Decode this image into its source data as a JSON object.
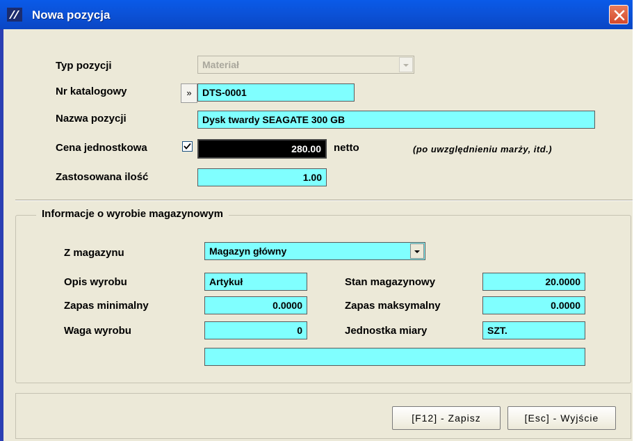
{
  "window": {
    "title": "Nowa pozycja",
    "icon": "app-logo-icon",
    "close_icon": "close-icon"
  },
  "header": {
    "type_label": "Typ pozycji",
    "type_value": "Materiał",
    "catalog_label": "Nr katalogowy",
    "catalog_button": "»",
    "catalog_value": "DTS-0001",
    "name_label": "Nazwa pozycji",
    "name_value": "Dysk twardy SEAGATE 300 GB",
    "price_label": "Cena jednostkowa",
    "price_checked": true,
    "price_value": "280.00",
    "price_suffix": "netto",
    "price_note": "(po uwzględnieniu marży, itd.)",
    "qty_label": "Zastosowana ilość",
    "qty_value": "1.00"
  },
  "warehouse": {
    "legend": "Informacje o wyrobie magazynowym",
    "from_label": "Z magazynu",
    "from_value": "Magazyn główny",
    "desc_label": "Opis wyrobu",
    "desc_value": "Artykuł",
    "stock_label": "Stan magazynowy",
    "stock_value": "20.0000",
    "min_label": "Zapas minimalny",
    "min_value": "0.0000",
    "max_label": "Zapas maksymalny",
    "max_value": "0.0000",
    "weight_label": "Waga wyrobu",
    "weight_value": "0",
    "unit_label": "Jednostka miary",
    "unit_value": "SZT.",
    "extra_value": ""
  },
  "buttons": {
    "save": "[F12] - Zapisz",
    "exit": "[Esc] - Wyjście"
  },
  "colors": {
    "field": "#80ffff",
    "titlebar": "#0a5ae8",
    "dialog": "#ece9d8",
    "price_field": "#000000"
  }
}
